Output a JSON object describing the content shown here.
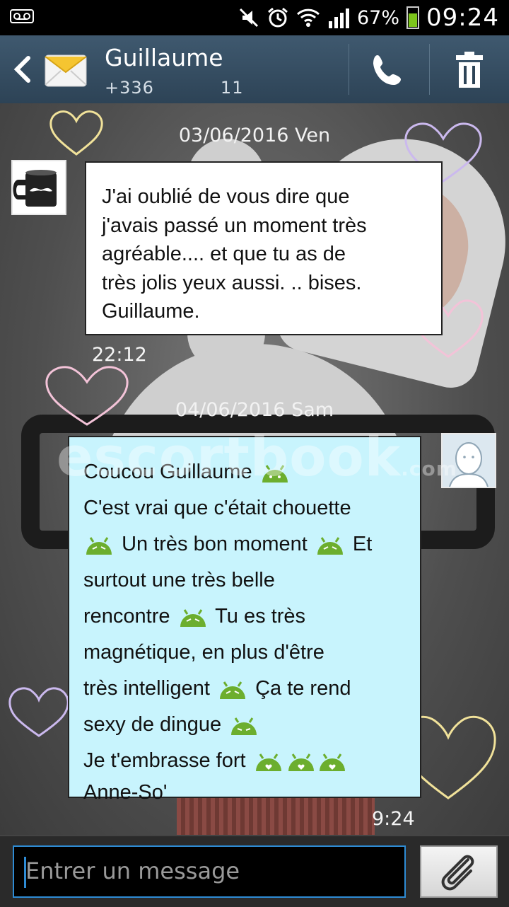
{
  "status_bar": {
    "battery": "67%",
    "time": "09:24",
    "icons": [
      "voicemail-icon",
      "mute-icon",
      "alarm-icon",
      "wifi-icon",
      "signal-icon",
      "battery-icon"
    ]
  },
  "header": {
    "contact_name": "Guillaume",
    "phone_start": "+336",
    "phone_end": "11"
  },
  "conversation": {
    "watermark": {
      "main": "escortbook",
      "suffix": ".com"
    },
    "messages": [
      {
        "date": "03/06/2016 Ven",
        "direction": "received",
        "lines": [
          "J'ai oublié de vous dire que",
          "j'avais passé un moment très",
          "agréable.... et que tu as de",
          "très jolis yeux aussi. .. bises.",
          "Guillaume."
        ],
        "time": "22:12"
      },
      {
        "date": "04/06/2016 Sam",
        "direction": "sent",
        "lines": [
          {
            "a": "Coucou Guillaume",
            "emoji": 1
          },
          {
            "a": "C'est vrai que c'était chouette",
            "emoji": 0
          },
          {
            "a": "",
            "emoji": 1,
            "b": "Un très bon moment",
            "emoji2": 1,
            "c": "Et"
          },
          {
            "a": "surtout une très belle",
            "emoji": 0
          },
          {
            "a": "rencontre",
            "emoji": 1,
            "b": "Tu es très"
          },
          {
            "a": "magnétique, en plus d'être",
            "emoji": 0
          },
          {
            "a": "très intelligent",
            "emoji": 1,
            "b": "Ça te rend"
          },
          {
            "a": "sexy de dingue",
            "emoji": 1
          },
          {
            "a": "Je t'embrasse fort",
            "emoji": 3
          },
          {
            "a": "Anne-So'",
            "emoji": 0
          }
        ],
        "time": "9:24"
      }
    ]
  },
  "composer": {
    "placeholder": "Entrer un message"
  }
}
